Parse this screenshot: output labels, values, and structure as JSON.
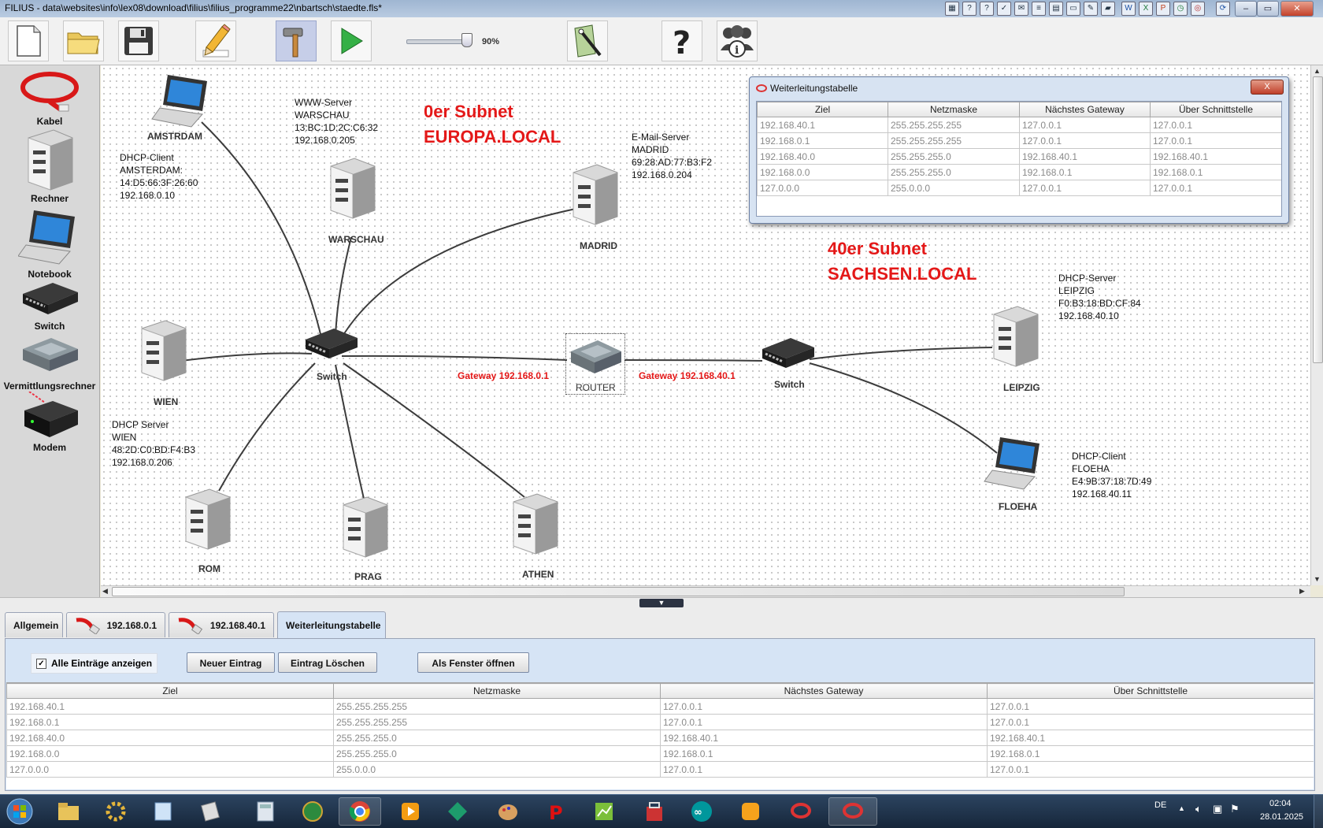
{
  "window": {
    "title": "FILIUS - data\\websites\\info\\lex08\\download\\filius\\filius_programme22\\nbartsch\\staedte.fls*",
    "controls": [
      "minimize",
      "maximize",
      "close"
    ]
  },
  "toolbar": {
    "buttons": [
      {
        "name": "new-file",
        "icon": "blank-page-icon"
      },
      {
        "name": "open",
        "icon": "folder-icon"
      },
      {
        "name": "save",
        "icon": "floppy-disk-icon"
      },
      {
        "name": "design-mode",
        "icon": "pencil-icon"
      },
      {
        "name": "simulation-mode",
        "icon": "hammer-icon"
      },
      {
        "name": "run",
        "icon": "play-icon"
      },
      {
        "name": "wizard",
        "icon": "document-wizard-icon"
      },
      {
        "name": "help",
        "icon": "question-mark-icon"
      },
      {
        "name": "about",
        "icon": "people-info-icon"
      }
    ],
    "zoom": {
      "value": 0.9,
      "label": "90%"
    }
  },
  "palette": {
    "items": [
      {
        "label": "Kabel",
        "icon": "cable-icon"
      },
      {
        "label": "Rechner",
        "icon": "server-tower-icon"
      },
      {
        "label": "Notebook",
        "icon": "laptop-icon"
      },
      {
        "label": "Switch",
        "icon": "switch-icon"
      },
      {
        "label": "Vermittlungsrechner",
        "icon": "router-icon"
      },
      {
        "label": "Modem",
        "icon": "modem-icon"
      }
    ]
  },
  "network": {
    "subnet_europa": "0er Subnet\nEUROPA.LOCAL",
    "subnet_sachsen": "40er Subnet\nSACHSEN.LOCAL",
    "gateway_left": "Gateway 192.168.0.1",
    "gateway_right": "Gateway 192.168.40.1",
    "nodes": {
      "amstrdam": "AMSTRDAM",
      "warschau": "WARSCHAU",
      "madrid": "MADRID",
      "wien": "WIEN",
      "switch_left": "Switch",
      "router": "ROUTER",
      "switch_right": "Switch",
      "leipzig": "LEIPZIG",
      "floeha": "FLOEHA",
      "rom": "ROM",
      "prag": "PRAG",
      "athen": "ATHEN"
    },
    "notes": {
      "amsterdam": "DHCP-Client\nAMSTERDAM:\n14:D5:66:3F:26:60\n192.168.0.10",
      "warschau": "WWW-Server\nWARSCHAU\n13:BC:1D:2C:C6:32\n192.168.0.205",
      "madrid": "E-Mail-Server\nMADRID\n69:28:AD:77:B3:F2\n192.168.0.204",
      "wien": "DHCP Server\nWIEN\n48:2D:C0:BD:F4:B3\n192.168.0.206",
      "leipzig": "DHCP-Server\nLEIPZIG\nF0:B3:18:BD:CF:84\n192.168.40.10",
      "floeha": "DHCP-Client\nFLOEHA\nE4:9B:37:18:7D:49\n192.168.40.11"
    }
  },
  "floating_window": {
    "title": "Weiterleitungstabelle",
    "close_label": "X"
  },
  "routing_table": {
    "columns": [
      "Ziel",
      "Netzmaske",
      "Nächstes Gateway",
      "Über Schnittstelle"
    ],
    "rows": [
      [
        "192.168.40.1",
        "255.255.255.255",
        "127.0.0.1",
        "127.0.0.1"
      ],
      [
        "192.168.0.1",
        "255.255.255.255",
        "127.0.0.1",
        "127.0.0.1"
      ],
      [
        "192.168.40.0",
        "255.255.255.0",
        "192.168.40.1",
        "192.168.40.1"
      ],
      [
        "192.168.0.0",
        "255.255.255.0",
        "192.168.0.1",
        "192.168.0.1"
      ],
      [
        "127.0.0.0",
        "255.0.0.0",
        "127.0.0.1",
        "127.0.0.1"
      ]
    ]
  },
  "bottom_panel": {
    "tabs": [
      {
        "label": "Allgemein",
        "icon": null
      },
      {
        "label": "192.168.0.1",
        "icon": "cable-icon"
      },
      {
        "label": "192.168.40.1",
        "icon": "cable-icon"
      },
      {
        "label": "Weiterleitungstabelle",
        "icon": null,
        "active": true
      }
    ],
    "checkbox_label": "Alle Einträge anzeigen",
    "checkbox_checked": true,
    "btn_new": "Neuer Eintrag",
    "btn_delete": "Eintrag Löschen",
    "btn_window": "Als Fenster öffnen"
  },
  "taskbar": {
    "apps": [
      "windows-start-icon",
      "file-explorer-icon",
      "gear-app-icon",
      "notepad-icon",
      "script-icon",
      "calculator-icon",
      "globe-app-icon",
      "chrome-icon",
      "media-player-icon",
      "green-app-icon",
      "paint-icon",
      "p-app-icon",
      "green-chart-icon",
      "bag-app-icon",
      "arduino-icon",
      "orange-app-icon",
      "filius-icon",
      "filius-active-icon"
    ],
    "language": "DE",
    "time": "02:04",
    "date": "28.01.2025"
  }
}
